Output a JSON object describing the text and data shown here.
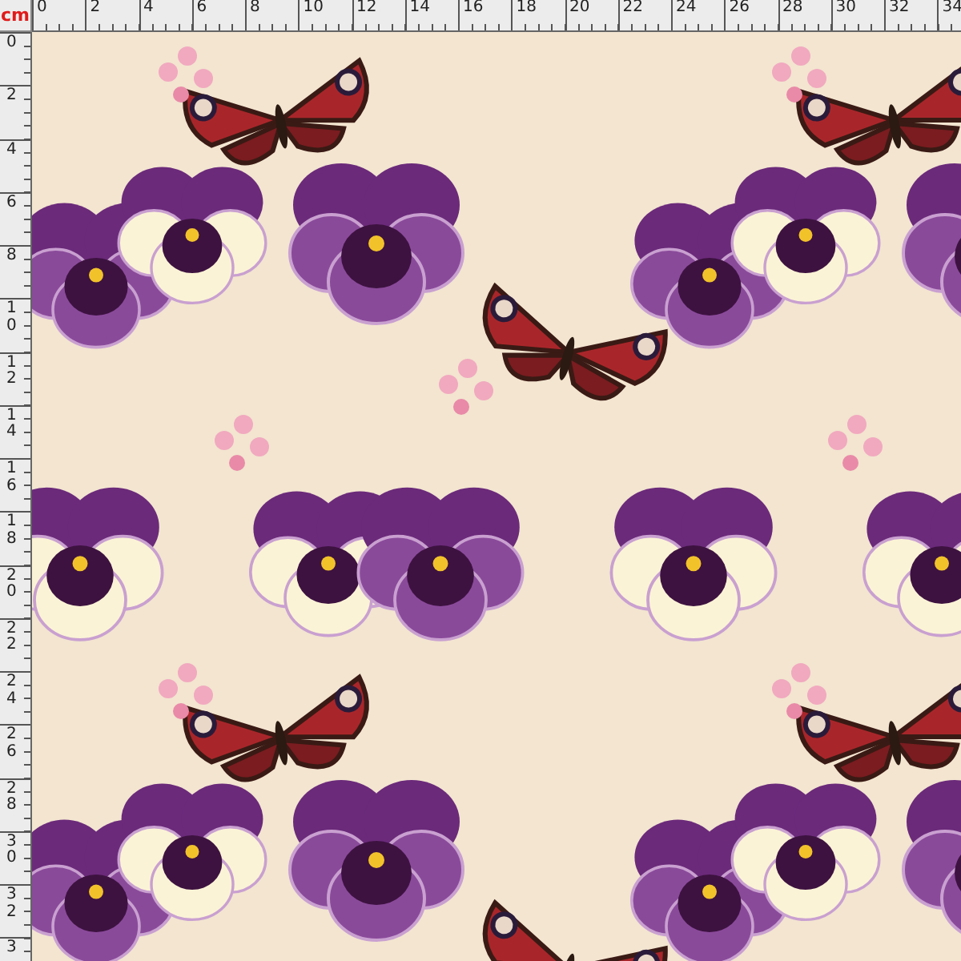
{
  "rulers": {
    "unit": "cm",
    "horizontal": [
      "0",
      "2",
      "4",
      "6",
      "8",
      "10",
      "12",
      "14",
      "16",
      "18",
      "20",
      "22",
      "24",
      "26",
      "28",
      "30",
      "32",
      "34"
    ],
    "vertical": [
      "0",
      "2",
      "4",
      "6",
      "8",
      "10",
      "12",
      "14",
      "16",
      "18",
      "20",
      "22",
      "24",
      "26",
      "28",
      "30",
      "32",
      "3"
    ]
  }
}
